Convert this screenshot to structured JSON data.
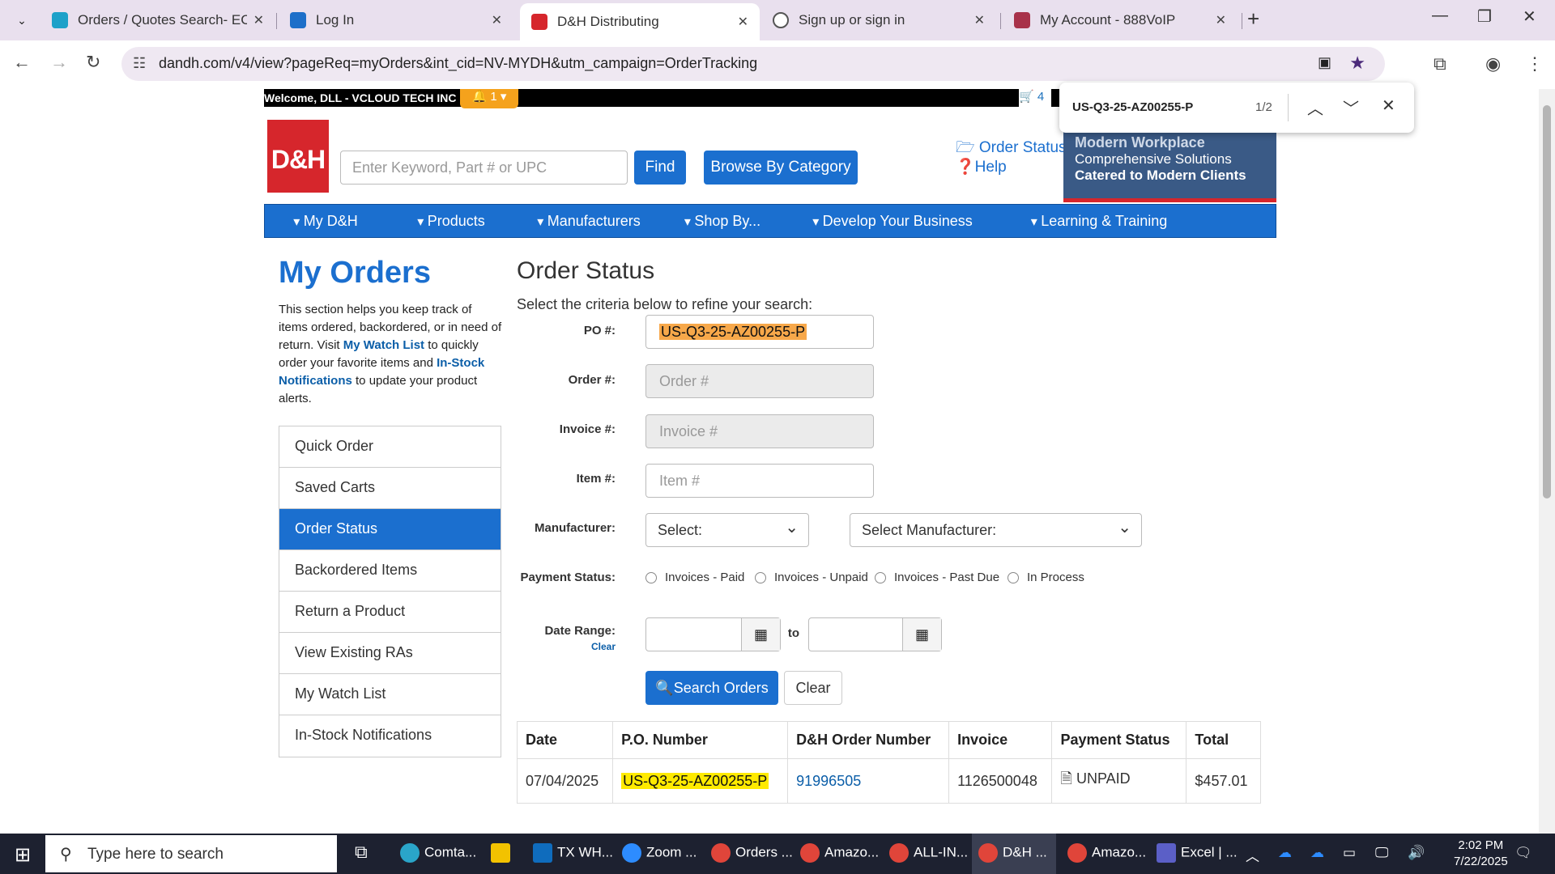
{
  "browser": {
    "tabs": [
      {
        "title": "Orders / Quotes Search- ECExp",
        "fav": "#1da1c9"
      },
      {
        "title": "Log In",
        "fav": "#1d6fc9"
      },
      {
        "title": "D&H Distributing",
        "fav": "#d6262c"
      },
      {
        "title": "Sign up or sign in",
        "fav": "#555555"
      },
      {
        "title": "My Account - 888VoIP",
        "fav": "#a8324a"
      }
    ],
    "url": "dandh.com/v4/view?pageReq=myOrders&int_cid=NV-MYDH&utm_campaign=OrderTracking",
    "find": {
      "query": "US-Q3-25-AZ00255-P",
      "count": "1/2"
    }
  },
  "site": {
    "welcome": "Welcome, DLL - VCLOUD TECH INC",
    "notif_count": "1",
    "cart_count": "4",
    "logo": "D&H",
    "search_placeholder": "Enter Keyword, Part # or UPC",
    "find_label": "Find",
    "browse_label": "Browse By Category",
    "order_status_link": "Order Status",
    "help_link": "Help",
    "banner": {
      "line1": "Modern Workplace",
      "line2": "Comprehensive Solutions",
      "line3": "Catered to Modern Clients"
    },
    "nav": [
      "My D&H",
      "Products",
      "Manufacturers",
      "Shop By...",
      "Develop Your Business",
      "Learning & Training"
    ]
  },
  "left": {
    "title": "My Orders",
    "intro_1": "This section helps you keep track of items ordered, backordered, or in need of return. Visit ",
    "intro_link1": "My Watch List",
    "intro_2": " to quickly order your favorite items and ",
    "intro_link2": "In-Stock Notifications",
    "intro_3": " to update your product alerts.",
    "menu": [
      "Quick Order",
      "Saved Carts",
      "Order Status",
      "Backordered Items",
      "Return a Product",
      "View Existing RAs",
      "My Watch List",
      "In-Stock Notifications"
    ]
  },
  "form": {
    "title": "Order Status",
    "criteria": "Select the criteria below to refine your search:",
    "po_label": "PO #:",
    "po_value": "US-Q3-25-AZ00255-P",
    "order_label": "Order #:",
    "order_ph": "Order #",
    "invoice_label": "Invoice #:",
    "invoice_ph": "Invoice #",
    "item_label": "Item #:",
    "item_ph": "Item #",
    "mfr_label": "Manufacturer:",
    "mfr_select1": "Select:",
    "mfr_select2": "Select Manufacturer:",
    "pay_label": "Payment Status:",
    "pay_options": [
      "Invoices - Paid",
      "Invoices - Unpaid",
      "Invoices - Past Due",
      "In Process"
    ],
    "date_label": "Date Range:",
    "date_clear": "Clear",
    "date_to": "to",
    "search_btn": "Search Orders",
    "clear_btn": "Clear"
  },
  "results": {
    "headers": [
      "Date",
      "P.O. Number",
      "D&H Order Number",
      "Invoice",
      "Payment Status",
      "Total"
    ],
    "rows": [
      {
        "date": "07/04/2025",
        "po": "US-Q3-25-AZ00255-P",
        "order": "91996505",
        "invoice": "1126500048",
        "status": "UNPAID",
        "total": "$457.01"
      }
    ]
  },
  "taskbar": {
    "search": "Type here to search",
    "apps": [
      {
        "label": "Comta...",
        "color": "#2aa5c9"
      },
      {
        "label": "",
        "color": "#f2c200"
      },
      {
        "label": "TX WH...",
        "color": "#0f6cbd"
      },
      {
        "label": "Zoom ...",
        "color": "#2d8cff"
      },
      {
        "label": "Orders ...",
        "color": "#e0453a"
      },
      {
        "label": "Amazo...",
        "color": "#e0453a"
      },
      {
        "label": "ALL-IN...",
        "color": "#e0453a"
      },
      {
        "label": "D&H ...",
        "color": "#e0453a"
      },
      {
        "label": "Amazo...",
        "color": "#e0453a"
      },
      {
        "label": "Excel | ...",
        "color": "#5b5fc7"
      }
    ],
    "time": "2:02 PM",
    "date": "7/22/2025"
  }
}
